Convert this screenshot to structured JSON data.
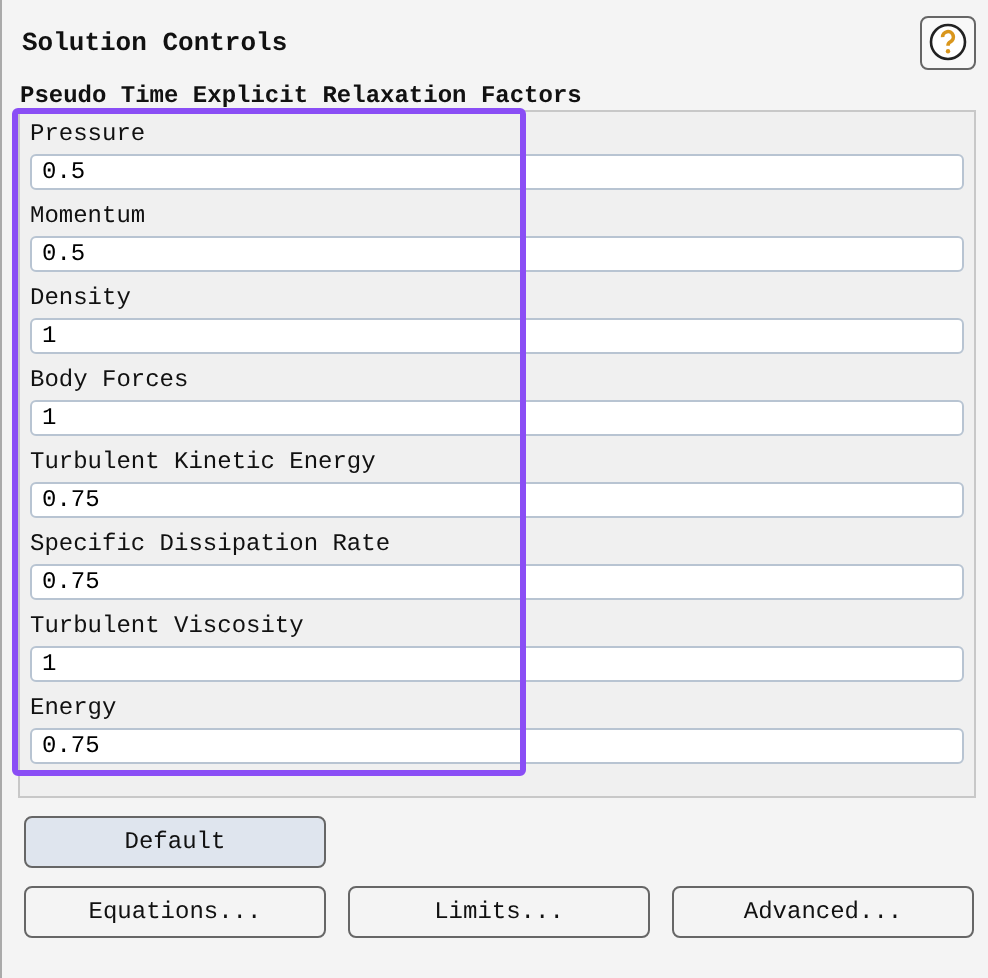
{
  "title": "Solution Controls",
  "group": {
    "label": "Pseudo Time Explicit Relaxation Factors",
    "fields": [
      {
        "label": "Pressure",
        "value": "0.5"
      },
      {
        "label": "Momentum",
        "value": "0.5"
      },
      {
        "label": "Density",
        "value": "1"
      },
      {
        "label": "Body Forces",
        "value": "1"
      },
      {
        "label": "Turbulent Kinetic Energy",
        "value": "0.75"
      },
      {
        "label": "Specific Dissipation Rate",
        "value": "0.75"
      },
      {
        "label": "Turbulent Viscosity",
        "value": "1"
      },
      {
        "label": "Energy",
        "value": "0.75"
      }
    ]
  },
  "default_button": "Default",
  "buttons": [
    "Equations...",
    "Limits...",
    "Advanced..."
  ]
}
